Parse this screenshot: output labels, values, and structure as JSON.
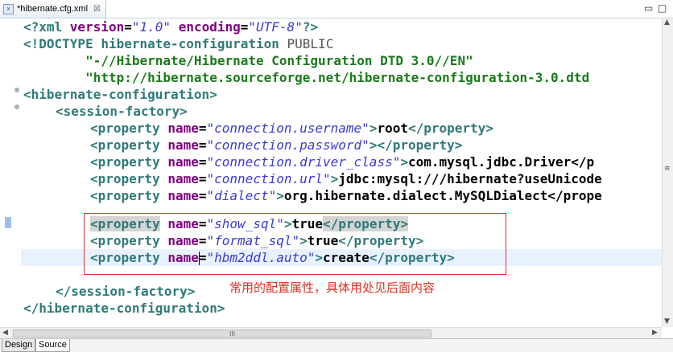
{
  "tab": {
    "title": "*hibernate.cfg.xml",
    "icon": "xml-file-icon",
    "close": "☒"
  },
  "window_controls": {
    "minimize": "▭",
    "maximize": "□"
  },
  "code": {
    "l1": {
      "open": "<?xml ",
      "a1": "version",
      "eq1": "=",
      "v1": "\"1.0\"",
      "sp": " ",
      "a2": "encoding",
      "eq2": "=",
      "v2": "\"UTF-8\"",
      "close": "?>"
    },
    "l2": {
      "kw": "<!DOCTYPE hibernate-configuration",
      "rest": " PUBLIC"
    },
    "l3": "        \"-//Hibernate/Hibernate Configuration DTD 3.0//EN\"",
    "l4": "        \"http://hibernate.sourceforge.net/hibernate-configuration-3.0.dtd",
    "l5": "<hibernate-configuration>",
    "l6": "<session-factory>",
    "props": [
      {
        "attr": "name",
        "value": "\"connection.username\"",
        "text": "root"
      },
      {
        "attr": "name",
        "value": "\"connection.password\"",
        "text": ""
      },
      {
        "attr": "name",
        "value": "\"connection.driver_class\"",
        "text": "com.mysql.jdbc.Driver</p"
      },
      {
        "attr": "name",
        "value": "\"connection.url\"",
        "text": "jdbc:mysql:///hibernate?useUnicode"
      },
      {
        "attr": "name",
        "value": "\"dialect\"",
        "text": "org.hibernate.dialect.MySQLDialect</prope"
      }
    ],
    "highlighted": [
      {
        "attr": "name",
        "value": "\"show_sql\"",
        "text": "true"
      },
      {
        "attr": "name",
        "value": "\"format_sql\"",
        "text": "true"
      },
      {
        "attr": "name",
        "value": "\"hbm2ddl.auto\"",
        "text": "create"
      }
    ],
    "prop_open": "<property",
    "prop_close": "</property>",
    "gt": ">",
    "eq": "=",
    "end_sf": "</session-factory>",
    "end_hc": "</hibernate-configuration>"
  },
  "annotation": "常用的配置属性，具体用处见后面内容",
  "bottom_tabs": {
    "design": "Design",
    "source": "Source"
  },
  "scroll": {
    "grip": "III"
  }
}
